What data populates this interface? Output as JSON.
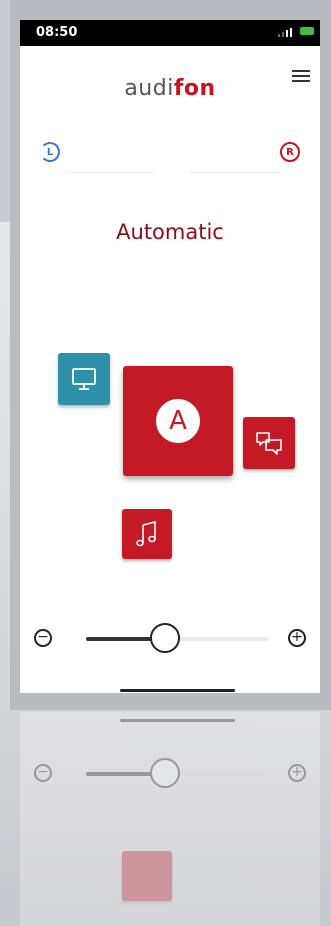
{
  "status_bar": {
    "time": "08:50"
  },
  "header": {
    "logo_prefix": "audi",
    "logo_accent": "fon"
  },
  "ears": {
    "left": "L",
    "right": "R"
  },
  "program": {
    "name": "Automatic"
  },
  "programs": [
    {
      "name": "TV",
      "icon": "monitor-icon"
    },
    {
      "name": "Automatic",
      "icon": "letter-a-icon",
      "letter": "A",
      "selected": true
    },
    {
      "name": "Conversation",
      "icon": "speech-bubbles-icon"
    },
    {
      "name": "Music",
      "icon": "music-note-icon"
    }
  ],
  "volume": {
    "minus": "−",
    "plus": "+",
    "level_fraction": 0.43
  },
  "colors": {
    "brand_red": "#c41a26",
    "tv_teal": "#2e8fa8",
    "left_ear_blue": "#3d7ac6"
  }
}
